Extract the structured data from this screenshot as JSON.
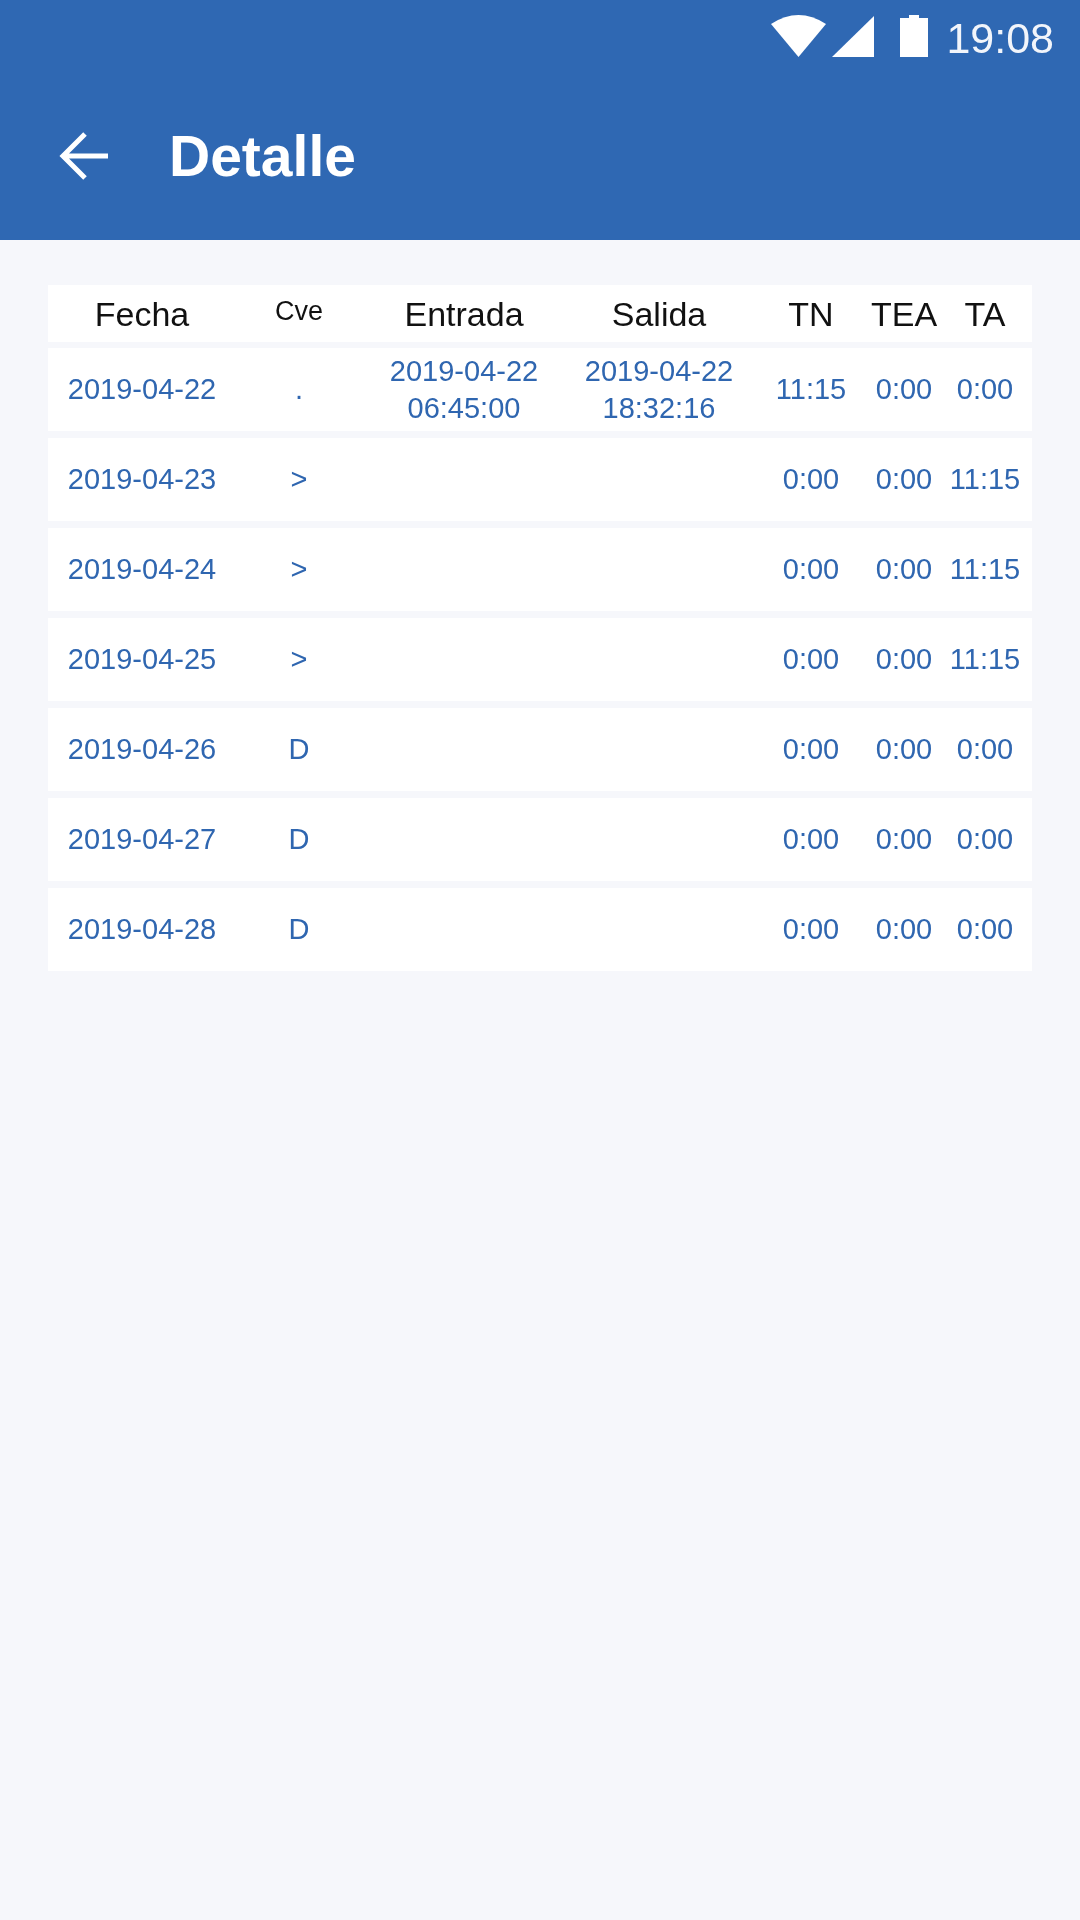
{
  "status_bar": {
    "time": "19:08"
  },
  "app_bar": {
    "title": "Detalle"
  },
  "table": {
    "columns": [
      "Fecha",
      "Cve",
      "Entrada",
      "Salida",
      "TN",
      "TEA",
      "TA"
    ],
    "rows": [
      {
        "fecha": "2019-04-22",
        "cve": ".",
        "entrada": "2019-04-22\n06:45:00",
        "salida": "2019-04-22\n18:32:16",
        "tn": "11:15",
        "tea": "0:00",
        "ta": "0:00"
      },
      {
        "fecha": "2019-04-23",
        "cve": ">",
        "tn": "0:00",
        "tea": "0:00",
        "ta": "11:15"
      },
      {
        "fecha": "2019-04-24",
        "cve": ">",
        "tn": "0:00",
        "tea": "0:00",
        "ta": "11:15"
      },
      {
        "fecha": "2019-04-25",
        "cve": ">",
        "tn": "0:00",
        "tea": "0:00",
        "ta": "11:15"
      },
      {
        "fecha": "2019-04-26",
        "cve": "D",
        "tn": "0:00",
        "tea": "0:00",
        "ta": "0:00"
      },
      {
        "fecha": "2019-04-27",
        "cve": "D",
        "tn": "0:00",
        "tea": "0:00",
        "ta": "0:00"
      },
      {
        "fecha": "2019-04-28",
        "cve": "D",
        "tn": "0:00",
        "tea": "0:00",
        "ta": "0:00"
      }
    ]
  }
}
